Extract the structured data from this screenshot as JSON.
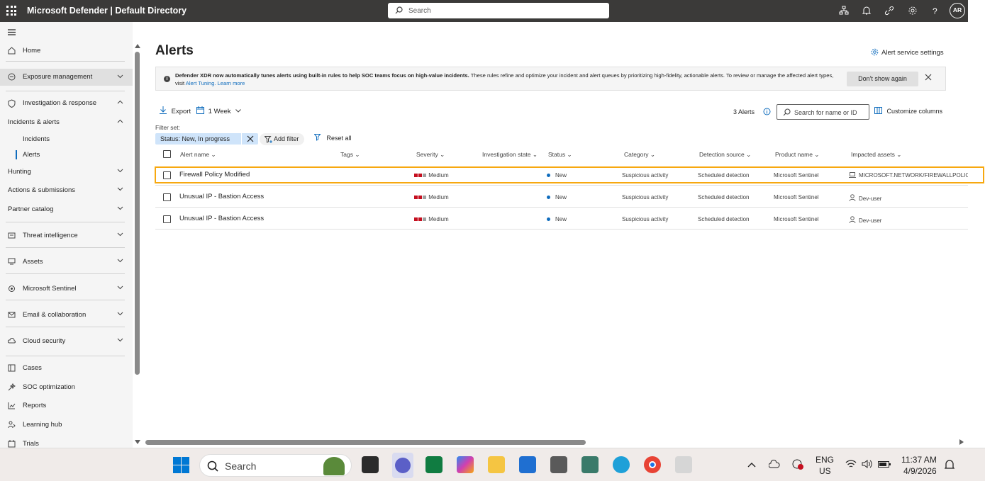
{
  "topbar": {
    "title": "Microsoft Defender | Default Directory",
    "search_placeholder": "Search",
    "avatar_initials": "AR"
  },
  "sidebar": {
    "items": [
      {
        "label": "Home",
        "icon": "home-icon"
      },
      {
        "label": "Exposure management",
        "icon": "exposure-icon"
      },
      {
        "label": "Investigation & response",
        "icon": "shield-icon"
      },
      {
        "label": "Incidents & alerts"
      },
      {
        "label": "Incidents"
      },
      {
        "label": "Alerts"
      },
      {
        "label": "Hunting"
      },
      {
        "label": "Actions & submissions"
      },
      {
        "label": "Partner catalog"
      },
      {
        "label": "Threat intelligence",
        "icon": "threat-icon"
      },
      {
        "label": "Assets",
        "icon": "assets-icon"
      },
      {
        "label": "Microsoft Sentinel",
        "icon": "sentinel-icon"
      },
      {
        "label": "Email & collaboration",
        "icon": "mail-icon"
      },
      {
        "label": "Cloud security",
        "icon": "cloud-icon"
      },
      {
        "label": "Cases",
        "icon": "cases-icon"
      },
      {
        "label": "SOC optimization",
        "icon": "soc-icon"
      },
      {
        "label": "Reports",
        "icon": "reports-icon"
      },
      {
        "label": "Learning hub",
        "icon": "learning-icon"
      },
      {
        "label": "Trials",
        "icon": "trials-icon"
      }
    ]
  },
  "page": {
    "title": "Alerts",
    "service_settings": "Alert service settings",
    "banner": {
      "bold": "Defender XDR now automatically tunes alerts using built-in rules to help SOC teams focus on high-value incidents.",
      "text": " These rules refine and optimize your incident and alert queues by prioritizing high-fidelity, actionable alerts. To review or manage the affected alert types, visit ",
      "link1": "Alert Tuning.",
      "link2": "Learn more",
      "dismiss": "Don't show again"
    },
    "toolbar": {
      "export": "Export",
      "range": "1 Week",
      "count": "3 Alerts",
      "search_placeholder": "Search for name or ID",
      "customize": "Customize columns"
    },
    "filter": {
      "label": "Filter set:",
      "chip": "Status: New, In progress",
      "add": "Add filter",
      "reset": "Reset all"
    },
    "columns": [
      "Alert name",
      "Tags",
      "Severity",
      "Investigation state",
      "Status",
      "Category",
      "Detection source",
      "Product name",
      "Impacted assets"
    ],
    "rows": [
      {
        "name": "Firewall Policy Modified",
        "severity": "Medium",
        "status": "New",
        "category": "Suspicious activity",
        "source": "Scheduled detection",
        "product": "Microsoft Sentinel",
        "asset": "MICROSOFT.NETWORK/FIREWALLPOLICIES/",
        "asset_icon": "device-icon"
      },
      {
        "name": "Unusual IP - Bastion Access",
        "severity": "Medium",
        "status": "New",
        "category": "Suspicious activity",
        "source": "Scheduled detection",
        "product": "Microsoft Sentinel",
        "asset": "Dev-user",
        "asset_icon": "user-icon"
      },
      {
        "name": "Unusual IP - Bastion Access",
        "severity": "Medium",
        "status": "New",
        "category": "Suspicious activity",
        "source": "Scheduled detection",
        "product": "Microsoft Sentinel",
        "asset": "Dev-user",
        "asset_icon": "user-icon"
      }
    ]
  },
  "taskbar": {
    "search": "Search",
    "lang1": "ENG",
    "lang2": "US",
    "time": "11:37 AM",
    "date": "4/9/2026"
  },
  "colors": {
    "accent": "#0f6cbd",
    "highlight": "#f7a80f",
    "severity_high": "#c50f1f",
    "topbar": "#3b3a39"
  }
}
